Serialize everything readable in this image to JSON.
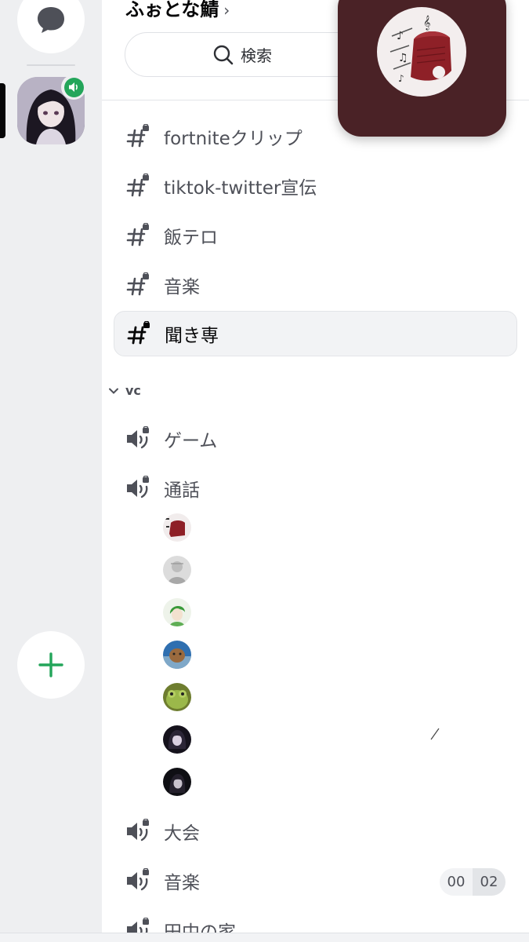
{
  "server": {
    "name": "ふぉとな鯖",
    "chevron": "›"
  },
  "search": {
    "label": "検索"
  },
  "text_channels": [
    {
      "name": "fortniteクリップ",
      "locked": true
    },
    {
      "name": "tiktok-twitter宣伝",
      "locked": true
    },
    {
      "name": "飯テロ",
      "locked": true
    },
    {
      "name": "音楽",
      "locked": true
    },
    {
      "name": "聞き専",
      "locked": true,
      "selected": true
    }
  ],
  "category": {
    "name": "vc"
  },
  "voice_channels": [
    {
      "name": "ゲーム"
    },
    {
      "name": "通話"
    },
    {
      "name": "大会"
    },
    {
      "name": "音楽",
      "user_count": "00",
      "user_limit": "02"
    },
    {
      "name": "田中の家"
    }
  ],
  "voice_users_count": 7,
  "colors": {
    "accent_green": "#23a55a",
    "selected_bg": "#f2f3f5",
    "bubble_bg": "#4a2226",
    "rail_bg": "#eeeff1"
  },
  "icons": {
    "dm": "chat-bubble-icon",
    "voice_badge": "speaker-icon",
    "add": "plus-icon",
    "search": "search-icon",
    "text_channel": "hashtag-lock-icon",
    "voice_channel": "speaker-lock-icon",
    "category": "chevron-down-icon"
  }
}
